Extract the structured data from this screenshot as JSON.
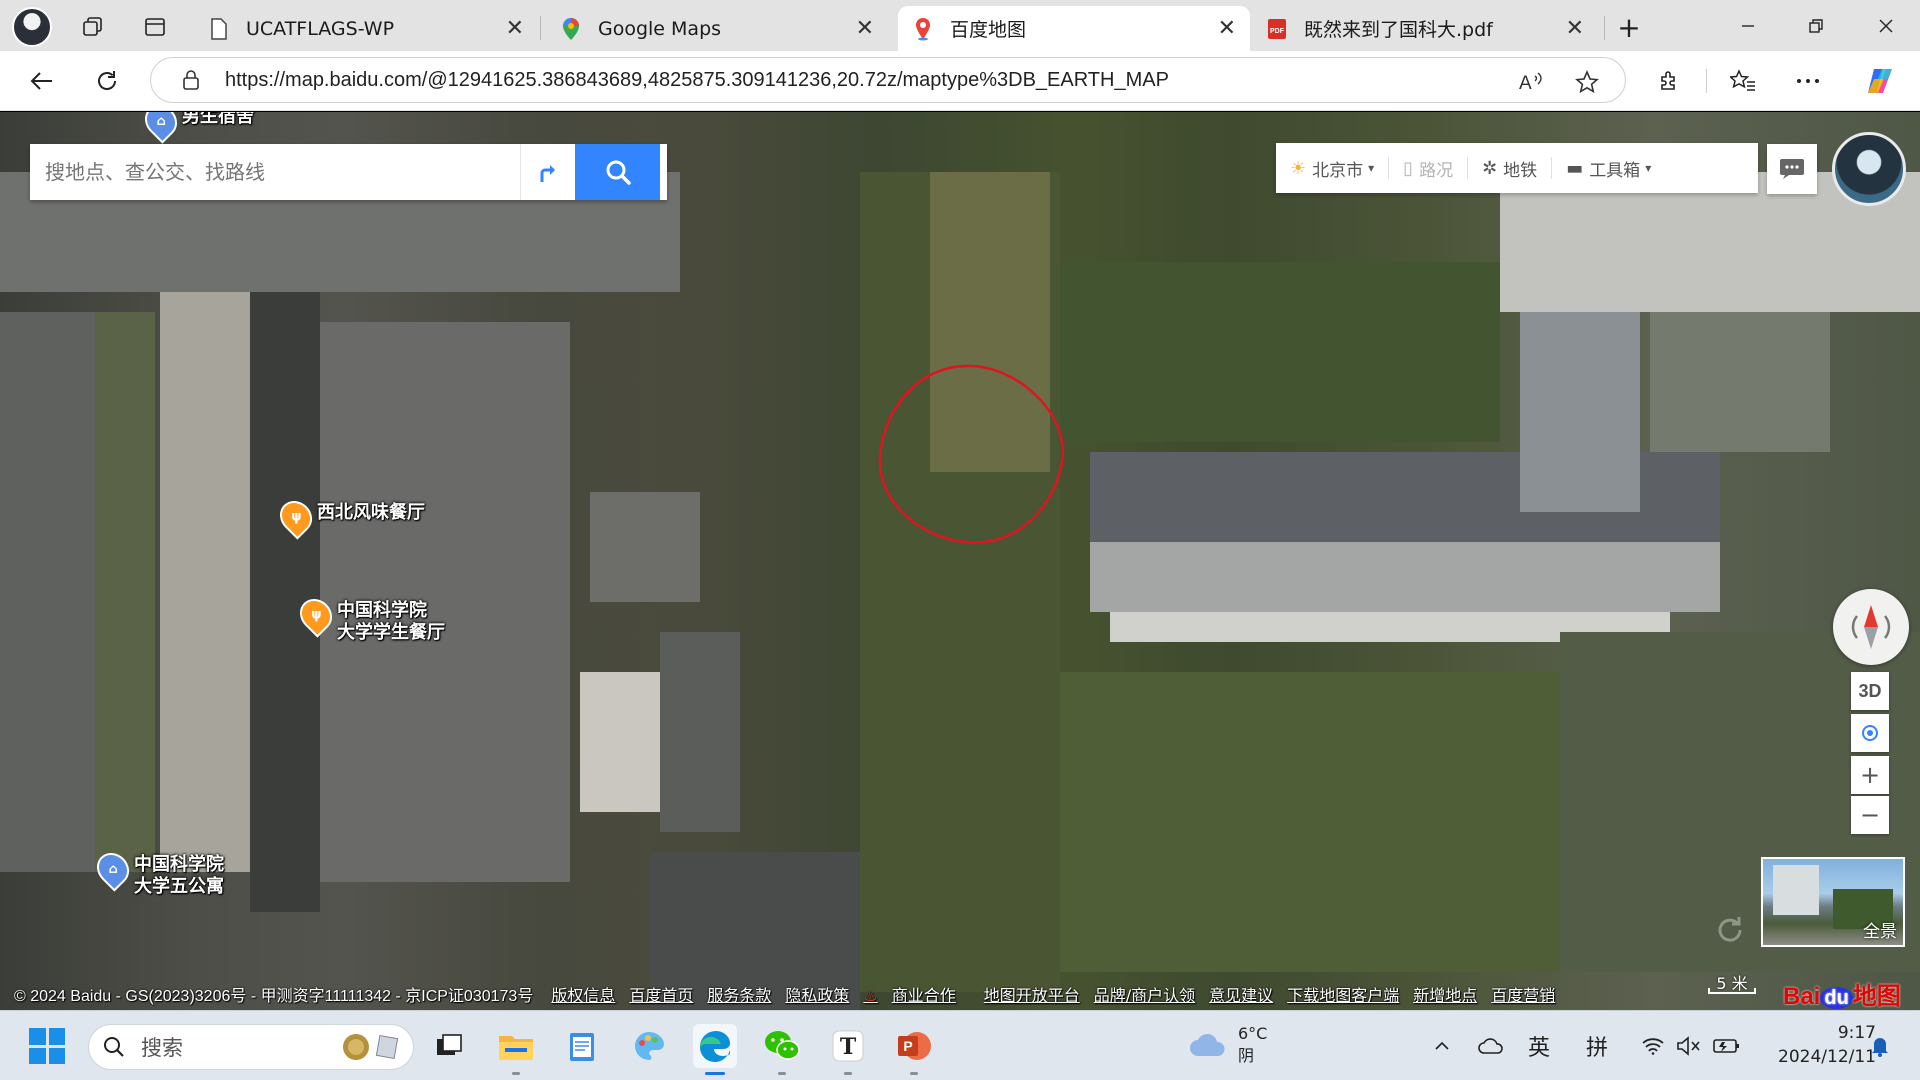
{
  "browser": {
    "tabs": [
      {
        "title": "UCATFLAGS-WP",
        "icon": "document-icon",
        "active": false
      },
      {
        "title": "Google Maps",
        "icon": "google-maps-icon",
        "active": false
      },
      {
        "title": "百度地图",
        "icon": "baidu-map-pin-icon",
        "active": true
      },
      {
        "title": "既然来到了国科大.pdf",
        "icon": "pdf-icon",
        "active": false
      }
    ],
    "close_glyph": "✕",
    "new_tab_glyph": "+",
    "url": "https://map.baidu.com/@12941625.386843689,4825875.309141236,20.72z/maptype%3DB_EARTH_MAP",
    "accent": "#3385ff"
  },
  "map": {
    "search_placeholder": "搜地点、查公交、找路线",
    "top_tools": {
      "city": "北京市",
      "traffic": "路况",
      "subway": "地铁",
      "toolbox": "工具箱"
    },
    "pois": [
      {
        "name": "男生宿舍",
        "icon": "building-icon"
      },
      {
        "name": "西北风味餐厅",
        "icon": "restaurant-icon"
      },
      {
        "name_line1": "中国科学院",
        "name_line2": "大学学生餐厅",
        "icon": "restaurant-icon"
      },
      {
        "name_line1": "中国科学院",
        "name_line2": "大学五公寓",
        "icon": "building-icon"
      }
    ],
    "controls": {
      "three_d": "3D",
      "zoom_in": "+",
      "zoom_out": "−"
    },
    "panorama_label": "全景",
    "scale_label": "5 米",
    "copyright": "© 2024 Baidu - GS(2023)3206号 - 甲测资字11111342 - 京ICP证030173号",
    "footer_links": [
      "版权信息",
      "百度首页",
      "服务条款",
      "隐私政策",
      "商业合作",
      "地图开放平台",
      "品牌/商户认领",
      "意见建议",
      "下载地图客户端",
      "新增地点",
      "百度营销"
    ],
    "logo": {
      "bai": "Bai",
      "du": "du",
      "suffix": "地图"
    },
    "annotation_color": "#e0141e"
  },
  "taskbar": {
    "search_label": "搜索",
    "weather_temp": "6°C",
    "weather_desc": "阴",
    "ime_lang": "英",
    "ime_mode": "拼",
    "time": "9:17",
    "date": "2024/12/11"
  }
}
